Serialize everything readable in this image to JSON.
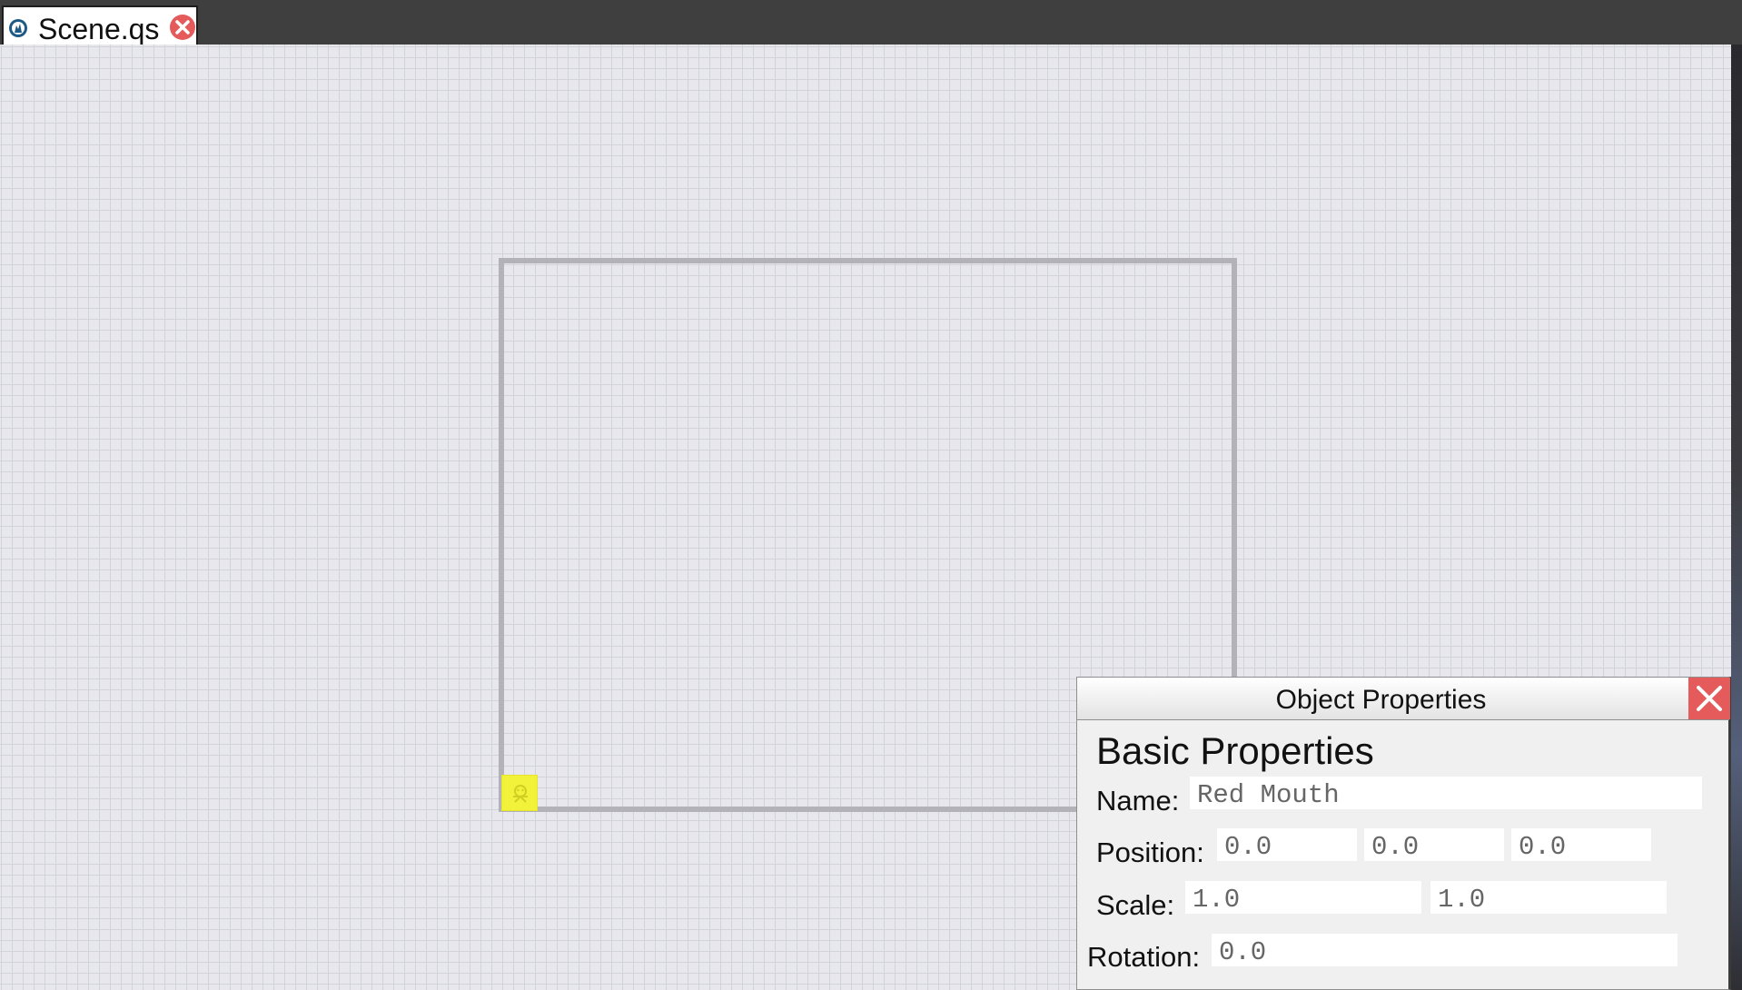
{
  "tab": {
    "label": "Scene.qs",
    "icon": "scene-file-icon",
    "close_icon": "close-circle-icon"
  },
  "scene": {
    "sprite_icon": "sprite-object-icon",
    "sprite_color": "#f2f23a"
  },
  "panel": {
    "title": "Object Properties",
    "close_icon": "close-x-icon",
    "section_title": "Basic Properties",
    "name": {
      "label": "Name:",
      "value": "Red Mouth"
    },
    "position": {
      "label": "Position:",
      "values": [
        "0.0",
        "0.0",
        "0.0"
      ]
    },
    "scale": {
      "label": "Scale:",
      "values": [
        "1.0",
        "1.0"
      ]
    },
    "rotation": {
      "label": "Rotation:",
      "value": "0.0"
    }
  },
  "colors": {
    "close_red": "#e55b5b",
    "topbar": "#3f3f3f",
    "canvas": "#e8e7ee",
    "grid_line": "#d2d2da",
    "scene_border": "#b3b2b8"
  }
}
